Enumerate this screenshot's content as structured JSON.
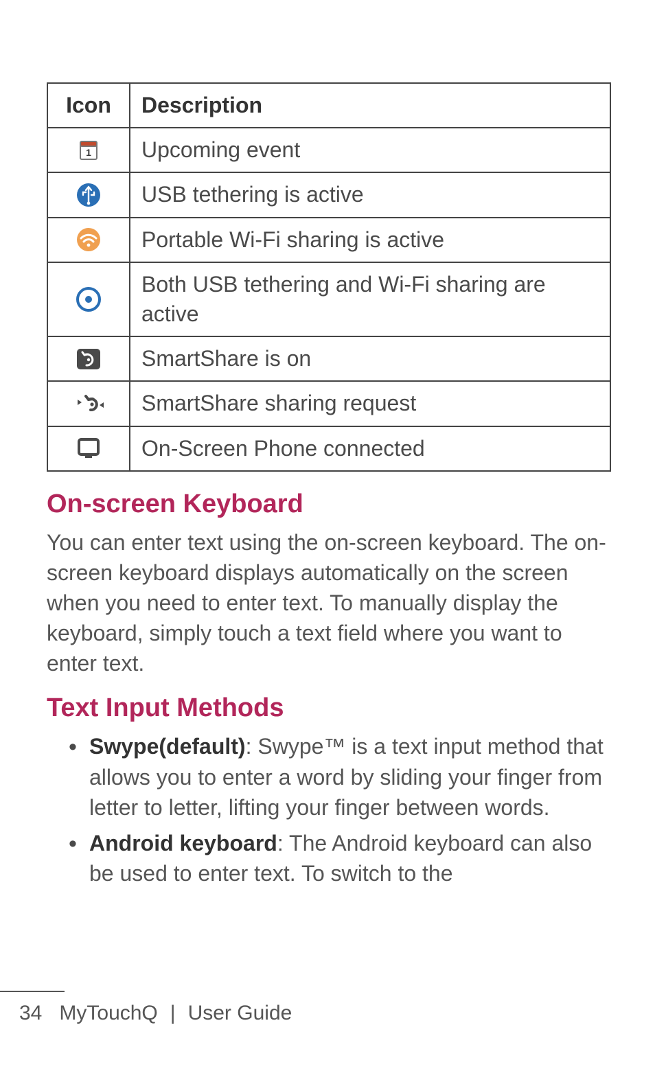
{
  "table": {
    "headers": {
      "icon": "Icon",
      "description": "Description"
    },
    "rows": [
      {
        "icon": "calendar-icon",
        "desc": "Upcoming event"
      },
      {
        "icon": "usb-tether-icon",
        "desc": "USB tethering is active"
      },
      {
        "icon": "wifi-circle-icon",
        "desc": "Portable Wi-Fi sharing is active"
      },
      {
        "icon": "tether-both-icon",
        "desc": "Both USB tethering and Wi-Fi sharing are active"
      },
      {
        "icon": "smartshare-on-icon",
        "desc": "SmartShare is on"
      },
      {
        "icon": "smartshare-request-icon",
        "desc": "SmartShare sharing request"
      },
      {
        "icon": "onscreen-phone-icon",
        "desc": "On-Screen Phone connected"
      }
    ]
  },
  "sections": {
    "keyboard": {
      "heading": "On-screen Keyboard",
      "body": "You can enter text using the on-screen keyboard. The on-screen keyboard displays automatically on the screen when you need to enter text. To manually display the keyboard, simply touch a text field where you want to enter text."
    },
    "input_methods": {
      "heading": "Text Input Methods",
      "items": [
        {
          "bold": "Swype(default)",
          "rest": ": Swype™ is a text input method that allows you to enter a word by sliding your finger from letter to letter, lifting your finger between words."
        },
        {
          "bold": "Android keyboard",
          "rest": ": The Android keyboard can also be used to enter text. To switch to the"
        }
      ]
    }
  },
  "footer": {
    "page_number": "34",
    "product": "MyTouchQ",
    "divider": "|",
    "doc": "User Guide"
  }
}
